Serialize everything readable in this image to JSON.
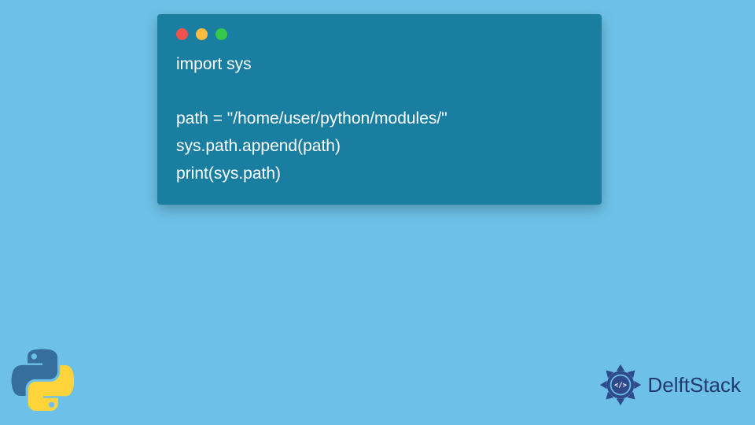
{
  "code": {
    "lines": [
      "import sys",
      "",
      "path = \"/home/user/python/modules/\"",
      "sys.path.append(path)",
      "print(sys.path)"
    ]
  },
  "traffic_lights": {
    "red": "#ef5350",
    "yellow": "#fdbc40",
    "green": "#34c749"
  },
  "brand": {
    "name": "DelftStack"
  },
  "colors": {
    "page_bg": "#6dc1e8",
    "window_bg": "#1a7ea1",
    "code_text": "#ffffff",
    "brand_text": "#223a6f",
    "python_blue": "#366f9e",
    "python_yellow": "#ffd43b"
  }
}
